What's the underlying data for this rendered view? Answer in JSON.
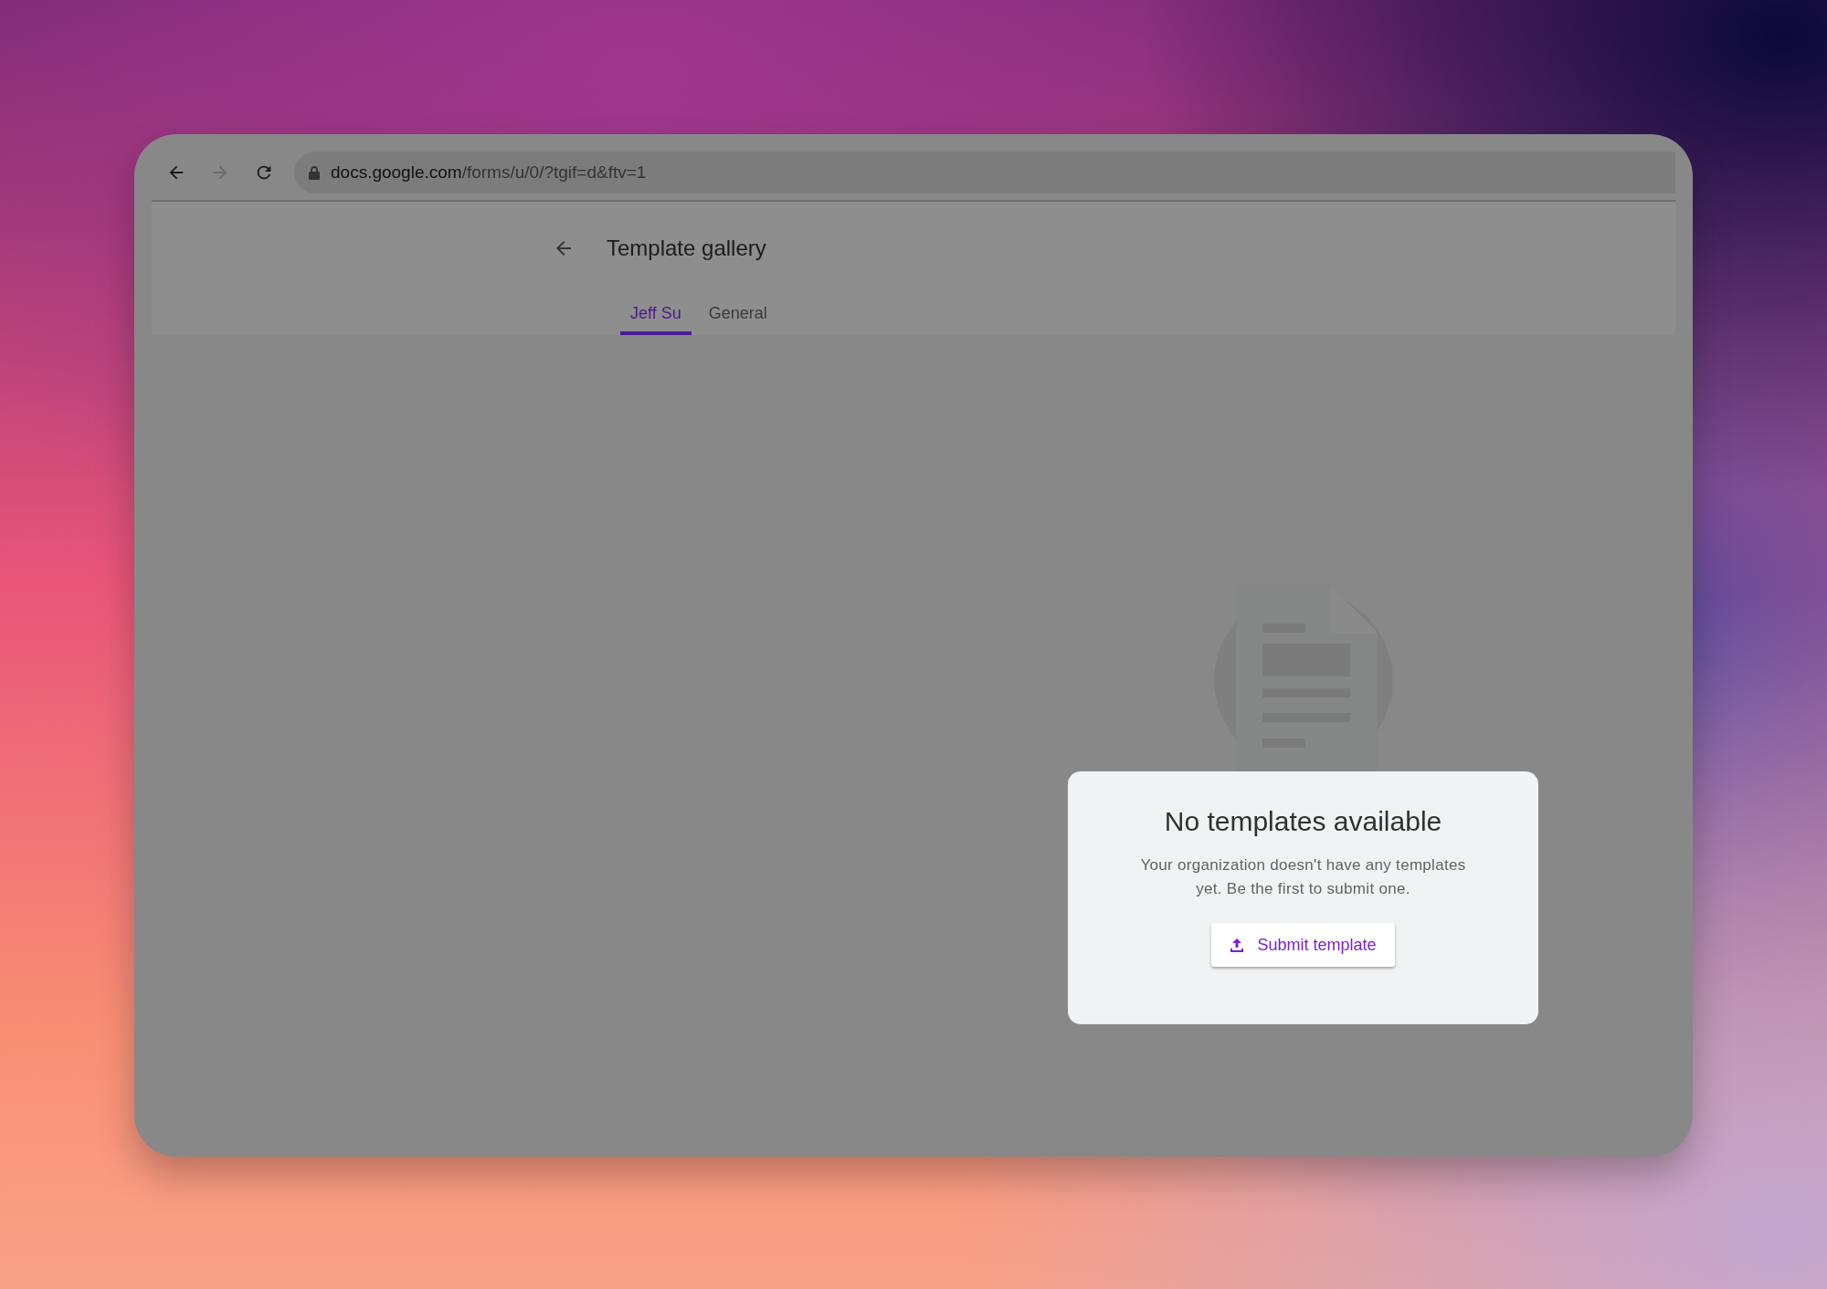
{
  "address_bar": {
    "domain": "docs.google.com",
    "path": "/forms/u/0/?tgif=d&ftv=1"
  },
  "header": {
    "title": "Template gallery"
  },
  "tabs": [
    {
      "label": "Jeff Su",
      "selected": true
    },
    {
      "label": "General",
      "selected": false
    }
  ],
  "empty_state": {
    "title": "No templates available",
    "message": "Your organization doesn't have any templates yet. Be the first to submit one.",
    "button": "Submit template"
  }
}
